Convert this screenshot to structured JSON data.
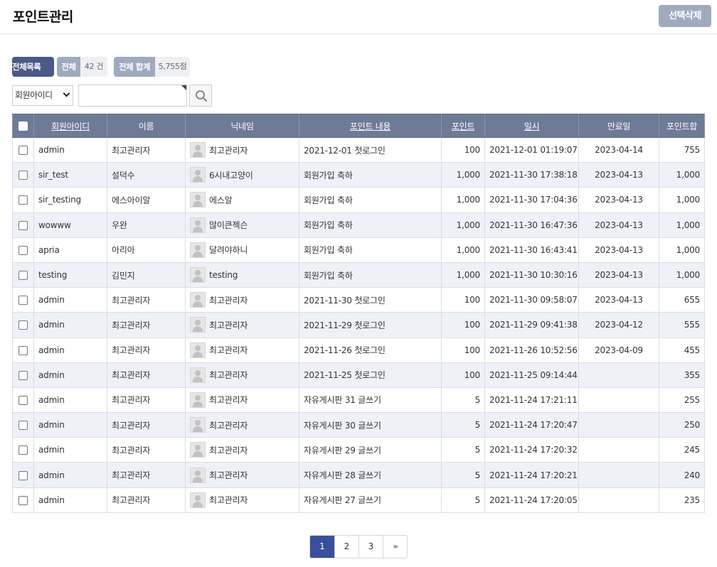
{
  "header": {
    "title": "포인트관리",
    "delete_button": "선택삭제"
  },
  "summary": {
    "all_list": "전체목록",
    "total_label": "전체",
    "total_value": "42 건",
    "sum_label": "전체 합계",
    "sum_value": "5,755점"
  },
  "search": {
    "field_selected": "회원아이디",
    "query": "",
    "search_icon": "search-icon"
  },
  "table": {
    "columns": [
      "회원아이디",
      "이름",
      "닉네임",
      "포인트 내용",
      "포인트",
      "일시",
      "만료일",
      "포인트합"
    ],
    "rows": [
      {
        "id": "admin",
        "name": "최고관리자",
        "nick": "최고관리자",
        "content": "2021-12-01 첫로그인",
        "point": "100",
        "datetime": "2021-12-01 01:19:07",
        "expire": "2023-04-14",
        "sum": "755"
      },
      {
        "id": "sir_test",
        "name": "설덕수",
        "nick": "6시내고양이",
        "content": "회원가입 축하",
        "point": "1,000",
        "datetime": "2021-11-30 17:38:18",
        "expire": "2023-04-13",
        "sum": "1,000"
      },
      {
        "id": "sir_testing",
        "name": "에스아이알",
        "nick": "에스알",
        "content": "회원가입 축하",
        "point": "1,000",
        "datetime": "2021-11-30 17:04:36",
        "expire": "2023-04-13",
        "sum": "1,000"
      },
      {
        "id": "wowww",
        "name": "우완",
        "nick": "많이큰젝슨",
        "content": "회원가입 축하",
        "point": "1,000",
        "datetime": "2021-11-30 16:47:36",
        "expire": "2023-04-13",
        "sum": "1,000"
      },
      {
        "id": "apria",
        "name": "아리아",
        "nick": "달려야하니",
        "content": "회원가입 축하",
        "point": "1,000",
        "datetime": "2021-11-30 16:43:41",
        "expire": "2023-04-13",
        "sum": "1,000"
      },
      {
        "id": "testing",
        "name": "김민지",
        "nick": "testing",
        "content": "회원가입 축하",
        "point": "1,000",
        "datetime": "2021-11-30 10:30:16",
        "expire": "2023-04-13",
        "sum": "1,000"
      },
      {
        "id": "admin",
        "name": "최고관리자",
        "nick": "최고관리자",
        "content": "2021-11-30 첫로그인",
        "point": "100",
        "datetime": "2021-11-30 09:58:07",
        "expire": "2023-04-13",
        "sum": "655"
      },
      {
        "id": "admin",
        "name": "최고관리자",
        "nick": "최고관리자",
        "content": "2021-11-29 첫로그인",
        "point": "100",
        "datetime": "2021-11-29 09:41:38",
        "expire": "2023-04-12",
        "sum": "555"
      },
      {
        "id": "admin",
        "name": "최고관리자",
        "nick": "최고관리자",
        "content": "2021-11-26 첫로그인",
        "point": "100",
        "datetime": "2021-11-26 10:52:56",
        "expire": "2023-04-09",
        "sum": "455"
      },
      {
        "id": "admin",
        "name": "최고관리자",
        "nick": "최고관리자",
        "content": "2021-11-25 첫로그인",
        "point": "100",
        "datetime": "2021-11-25 09:14:44",
        "expire": "",
        "sum": "355"
      },
      {
        "id": "admin",
        "name": "최고관리자",
        "nick": "최고관리자",
        "content": "자유게시판 31 글쓰기",
        "point": "5",
        "datetime": "2021-11-24 17:21:11",
        "expire": "",
        "sum": "255"
      },
      {
        "id": "admin",
        "name": "최고관리자",
        "nick": "최고관리자",
        "content": "자유게시판 30 글쓰기",
        "point": "5",
        "datetime": "2021-11-24 17:20:47",
        "expire": "",
        "sum": "250"
      },
      {
        "id": "admin",
        "name": "최고관리자",
        "nick": "최고관리자",
        "content": "자유게시판 29 글쓰기",
        "point": "5",
        "datetime": "2021-11-24 17:20:32",
        "expire": "",
        "sum": "245"
      },
      {
        "id": "admin",
        "name": "최고관리자",
        "nick": "최고관리자",
        "content": "자유게시판 28 글쓰기",
        "point": "5",
        "datetime": "2021-11-24 17:20:21",
        "expire": "",
        "sum": "240"
      },
      {
        "id": "admin",
        "name": "최고관리자",
        "nick": "최고관리자",
        "content": "자유게시판 27 글쓰기",
        "point": "5",
        "datetime": "2021-11-24 17:20:05",
        "expire": "",
        "sum": "235"
      }
    ]
  },
  "pagination": {
    "pages": [
      "1",
      "2",
      "3"
    ],
    "current": "1",
    "next_icon": "next-page-icon",
    "next_glyph": "▸▸"
  },
  "colors": {
    "header_bg": "#6e7b96",
    "accent": "#4a5a86",
    "muted": "#9faabf",
    "alt_row": "#eef2f8",
    "active_page": "#3a4f9c"
  }
}
